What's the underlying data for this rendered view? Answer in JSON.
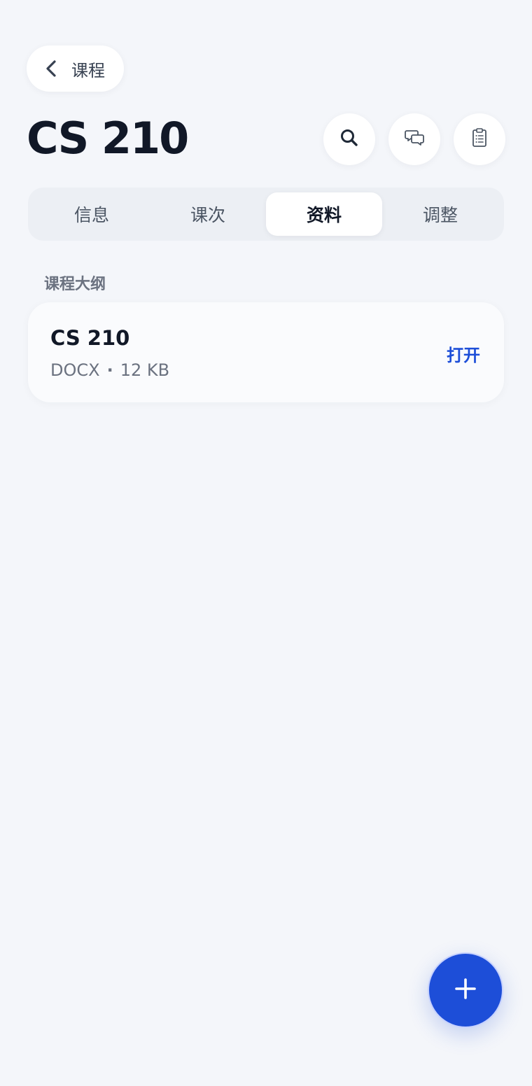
{
  "header": {
    "back_label": "课程",
    "title": "CS 210"
  },
  "tabs": [
    {
      "label": "信息",
      "active": false
    },
    {
      "label": "课次",
      "active": false
    },
    {
      "label": "资料",
      "active": true
    },
    {
      "label": "调整",
      "active": false
    }
  ],
  "section": {
    "label": "课程大纲"
  },
  "files": [
    {
      "name": "CS 210",
      "type": "DOCX",
      "separator": "·",
      "size": "12 KB",
      "action_label": "打开"
    }
  ],
  "icons": {
    "back": "chevron-left-icon",
    "search": "search-icon",
    "chat": "chat-bubbles-icon",
    "clipboard": "clipboard-list-icon",
    "fab": "plus-icon"
  },
  "colors": {
    "background": "#f4f6fa",
    "accent": "#1d4ed8",
    "title": "#111827",
    "muted": "#6b7280"
  }
}
